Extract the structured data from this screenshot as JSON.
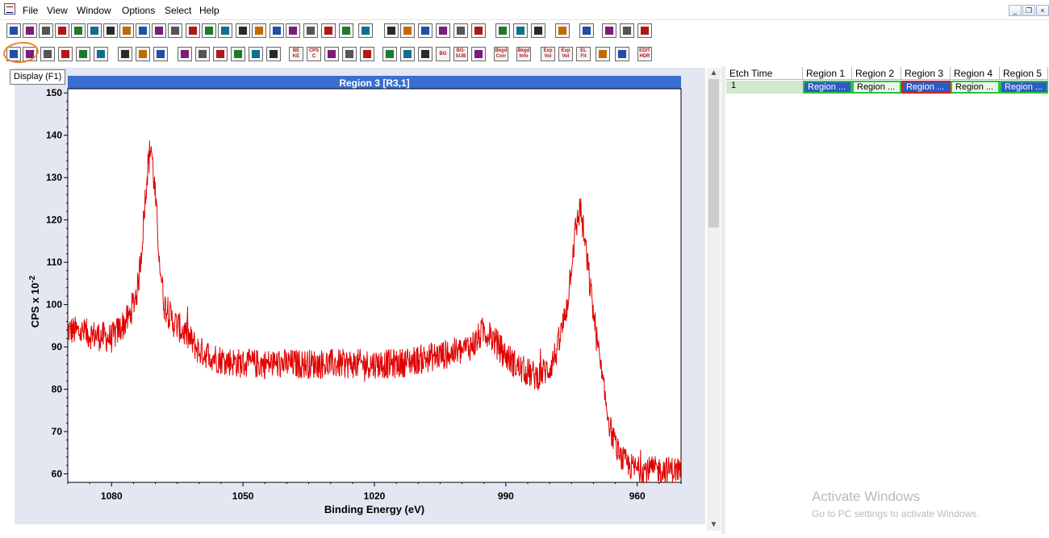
{
  "menu": [
    "File",
    "View",
    "Window",
    "Options",
    "Select",
    "Help"
  ],
  "window_controls": {
    "minimize": "_",
    "restore": "❐",
    "close": "×"
  },
  "tooltip": "Display (F1)",
  "toolbar_row2_text_buttons": [
    "BE KE",
    "CPS C",
    "BG",
    "BG- SUB",
    "Bkgd Corr",
    "Bkgd Info",
    "Exp Vol",
    "Exp Vol",
    "EL Fit",
    "EDIT HDR"
  ],
  "chart": {
    "title": "Region 3 [R3,1]",
    "xlabel": "Binding Energy (eV)",
    "ylabel": "CPS x 10",
    "ylabel_exp": "-2",
    "x_ticks": [
      "1080",
      "1050",
      "1020",
      "990",
      "960"
    ],
    "y_ticks": [
      "150",
      "140",
      "130",
      "120",
      "110",
      "100",
      "90",
      "80",
      "70",
      "60"
    ]
  },
  "chart_data": {
    "type": "line",
    "title": "Region 3 [R3,1]",
    "xlabel": "Binding Energy (eV)",
    "ylabel": "CPS x 10^-2",
    "xlim": [
      1090,
      950
    ],
    "ylim": [
      58,
      151
    ],
    "x_reversed": true,
    "grid": false,
    "series": [
      {
        "color": "#e00000",
        "x": [
          1090,
          1085,
          1080,
          1076,
          1074,
          1073,
          1072,
          1071,
          1070,
          1069,
          1068,
          1066,
          1063,
          1060,
          1055,
          1050,
          1045,
          1040,
          1035,
          1030,
          1025,
          1020,
          1015,
          1010,
          1005,
          1000,
          997,
          995,
          993,
          990,
          987,
          985,
          983,
          980,
          978,
          976,
          975,
          974,
          973,
          972,
          970,
          968,
          966,
          964,
          962,
          960,
          955,
          950
        ],
        "y": [
          94,
          93,
          92,
          97,
          104,
          115,
          130,
          138,
          125,
          110,
          100,
          96,
          93,
          89,
          87,
          86,
          86,
          86,
          86,
          86,
          86,
          86,
          86,
          87,
          88,
          89,
          91,
          94,
          92,
          88,
          85,
          84,
          83,
          85,
          90,
          100,
          110,
          118,
          123,
          115,
          98,
          82,
          70,
          64,
          62,
          61,
          61,
          61
        ]
      }
    ]
  },
  "grid": {
    "headers": [
      "Etch Time",
      "Region 1",
      "Region 2",
      "Region 3",
      "Region 4",
      "Region 5"
    ],
    "row": [
      "1",
      "Region ...",
      "Region ...",
      "Region ...",
      "Region ...",
      "Region ..."
    ]
  },
  "watermark": {
    "title": "Activate Windows",
    "subtitle": "Go to PC settings to activate Windows."
  },
  "colors": {
    "accent": "#3a6ed0",
    "trace": "#e00000",
    "selected_cell": "#2b5cc6",
    "active_region": "#d42020",
    "cell_border": "#2cc23a",
    "highlight": "#f0852c"
  }
}
